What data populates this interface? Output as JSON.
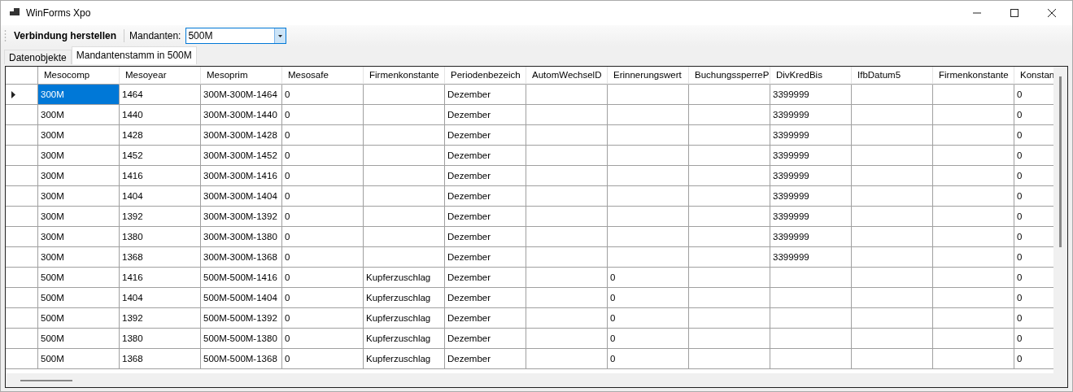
{
  "window": {
    "title": "WinForms Xpo"
  },
  "toolbar": {
    "connect_button": "Verbindung herstellen",
    "mandant_label": "Mandanten:",
    "mandant_value": "500M"
  },
  "tabs": [
    {
      "label": "Datenobjekte",
      "selected": false
    },
    {
      "label": "Mandantenstamm in 500M",
      "selected": true
    }
  ],
  "table": {
    "columns": [
      "Mesocomp",
      "Mesoyear",
      "Mesoprim",
      "Mesosafe",
      "Firmenkonstante",
      "Periodenbezeich",
      "AutomWechselD",
      "Erinnerungswert",
      "BuchungssperreP",
      "DivKredBis",
      "IfbDatum5",
      "Firmenkonstante",
      "Konstan"
    ],
    "rows": [
      {
        "selected": true,
        "cells": [
          "300M",
          "1464",
          "300M-300M-1464",
          "0",
          null,
          "Dezember",
          null,
          null,
          null,
          "3399999",
          null,
          null,
          "0"
        ]
      },
      {
        "selected": false,
        "cells": [
          "300M",
          "1440",
          "300M-300M-1440",
          "0",
          null,
          "Dezember",
          null,
          null,
          null,
          "3399999",
          null,
          null,
          "0"
        ]
      },
      {
        "selected": false,
        "cells": [
          "300M",
          "1428",
          "300M-300M-1428",
          "0",
          null,
          "Dezember",
          null,
          null,
          null,
          "3399999",
          null,
          null,
          "0"
        ]
      },
      {
        "selected": false,
        "cells": [
          "300M",
          "1452",
          "300M-300M-1452",
          "0",
          null,
          "Dezember",
          null,
          null,
          null,
          "3399999",
          null,
          null,
          "0"
        ]
      },
      {
        "selected": false,
        "cells": [
          "300M",
          "1416",
          "300M-300M-1416",
          "0",
          null,
          "Dezember",
          null,
          null,
          null,
          "3399999",
          null,
          null,
          "0"
        ]
      },
      {
        "selected": false,
        "cells": [
          "300M",
          "1404",
          "300M-300M-1404",
          "0",
          null,
          "Dezember",
          null,
          null,
          null,
          "3399999",
          null,
          null,
          "0"
        ]
      },
      {
        "selected": false,
        "cells": [
          "300M",
          "1392",
          "300M-300M-1392",
          "0",
          null,
          "Dezember",
          null,
          null,
          null,
          "3399999",
          null,
          null,
          "0"
        ]
      },
      {
        "selected": false,
        "cells": [
          "300M",
          "1380",
          "300M-300M-1380",
          "0",
          null,
          "Dezember",
          null,
          null,
          null,
          "3399999",
          null,
          null,
          "0"
        ]
      },
      {
        "selected": false,
        "cells": [
          "300M",
          "1368",
          "300M-300M-1368",
          "0",
          null,
          "Dezember",
          null,
          null,
          null,
          "3399999",
          null,
          null,
          "0"
        ]
      },
      {
        "selected": false,
        "cells": [
          "500M",
          "1416",
          "500M-500M-1416",
          "0",
          "Kupferzuschlag",
          "Dezember",
          null,
          "0",
          null,
          null,
          null,
          null,
          "0"
        ]
      },
      {
        "selected": false,
        "cells": [
          "500M",
          "1404",
          "500M-500M-1404",
          "0",
          "Kupferzuschlag",
          "Dezember",
          null,
          "0",
          null,
          null,
          null,
          null,
          "0"
        ]
      },
      {
        "selected": false,
        "cells": [
          "500M",
          "1392",
          "500M-500M-1392",
          "0",
          "Kupferzuschlag",
          "Dezember",
          null,
          "0",
          null,
          null,
          null,
          null,
          "0"
        ]
      },
      {
        "selected": false,
        "cells": [
          "500M",
          "1380",
          "500M-500M-1380",
          "0",
          "Kupferzuschlag",
          "Dezember",
          null,
          "0",
          null,
          null,
          null,
          null,
          "0"
        ]
      },
      {
        "selected": false,
        "cells": [
          "500M",
          "1368",
          "500M-500M-1368",
          "0",
          "Kupferzuschlag",
          "Dezember",
          null,
          "0",
          null,
          null,
          null,
          null,
          "0"
        ]
      }
    ]
  }
}
